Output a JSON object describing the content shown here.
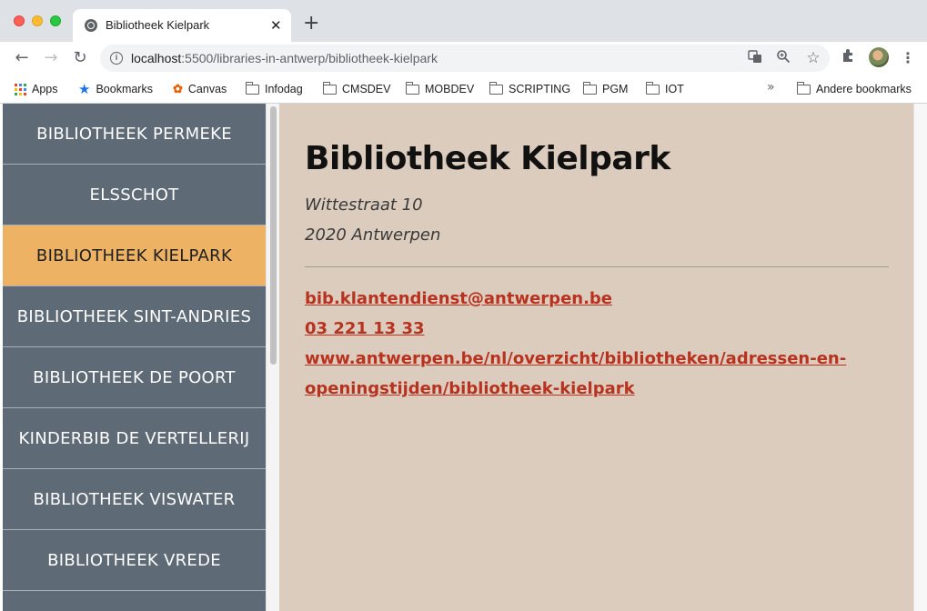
{
  "browser": {
    "tab_title": "Bibliotheek Kielpark",
    "tab_close": "✕",
    "new_tab": "+",
    "url_host": "localhost",
    "url_path": ":5500/libraries-in-antwerp/bibliotheek-kielpark",
    "nav": {
      "back": "←",
      "forward": "→",
      "reload": "↻"
    },
    "bookmarks": [
      {
        "label": "Apps"
      },
      {
        "label": "Bookmarks"
      },
      {
        "label": "Canvas"
      },
      {
        "label": "Infodag"
      },
      {
        "label": "CMSDEV"
      },
      {
        "label": "MOBDEV"
      },
      {
        "label": "SCRIPTING"
      },
      {
        "label": "PGM"
      },
      {
        "label": "IOT"
      }
    ],
    "more_bookmarks": "»",
    "other_bookmarks": "Andere bookmarks"
  },
  "sidebar": {
    "items": [
      {
        "label": "BIBLIOTHEEK PERMEKE",
        "active": false
      },
      {
        "label": "ELSSCHOT",
        "active": false
      },
      {
        "label": "BIBLIOTHEEK KIELPARK",
        "active": true
      },
      {
        "label": "BIBLIOTHEEK SINT-ANDRIES",
        "active": false
      },
      {
        "label": "BIBLIOTHEEK DE POORT",
        "active": false
      },
      {
        "label": "KINDERBIB DE VERTELLERIJ",
        "active": false
      },
      {
        "label": "BIBLIOTHEEK VISWATER",
        "active": false
      },
      {
        "label": "BIBLIOTHEEK VREDE",
        "active": false
      }
    ]
  },
  "library": {
    "name": "Bibliotheek Kielpark",
    "street": "Wittestraat 10",
    "city": "2020 Antwerpen",
    "email": "bib.klantendienst@antwerpen.be",
    "phone": "03 221 13 33",
    "website_line1": "www.antwerpen.be/nl/overzicht/bibliotheken/adressen-en-",
    "website_line2": "openingstijden/bibliotheek-kielpark"
  },
  "colors": {
    "sidebar_bg": "#5f6a77",
    "active_item": "#edb264",
    "content_bg": "#dbccbd",
    "link": "#b83220"
  }
}
